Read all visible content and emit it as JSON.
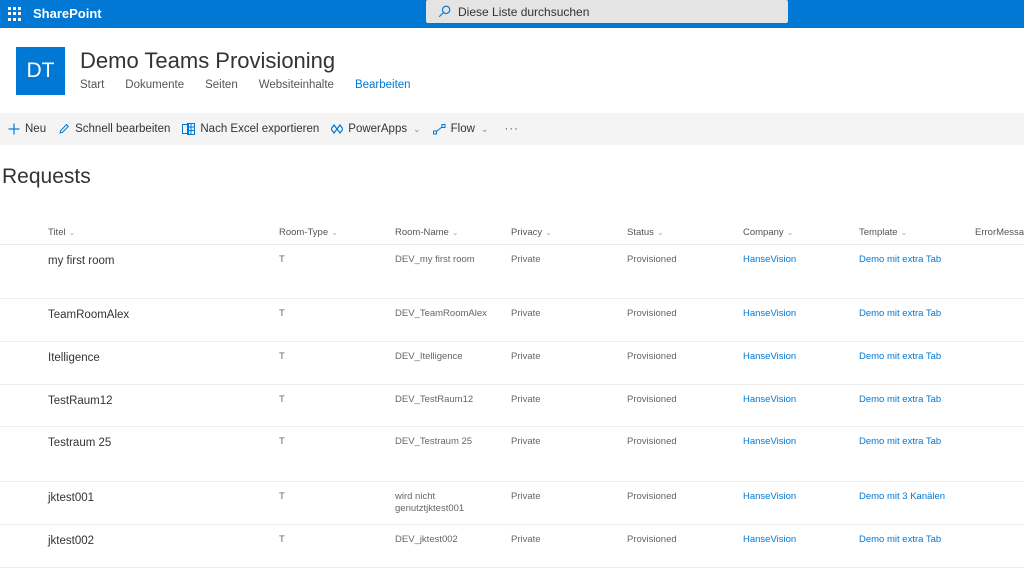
{
  "suitebar": {
    "app_name": "SharePoint",
    "search_placeholder": "Diese Liste durchsuchen",
    "accent_color": "#0078d4"
  },
  "site": {
    "logo_initials": "DT",
    "title": "Demo Teams Provisioning",
    "nav": [
      {
        "label": "Start",
        "active": false
      },
      {
        "label": "Dokumente",
        "active": false
      },
      {
        "label": "Seiten",
        "active": false
      },
      {
        "label": "Websiteinhalte",
        "active": false
      },
      {
        "label": "Bearbeiten",
        "active": true
      }
    ]
  },
  "commandbar": {
    "new_label": "Neu",
    "quick_edit_label": "Schnell bearbeiten",
    "export_label": "Nach Excel exportieren",
    "powerapps_label": "PowerApps",
    "flow_label": "Flow",
    "more_label": "···"
  },
  "list": {
    "title": "Requests",
    "columns": [
      "Titel",
      "Room-Type",
      "Room-Name",
      "Privacy",
      "Status",
      "Company",
      "Template",
      "ErrorMessag"
    ],
    "rows": [
      {
        "title": "my first room",
        "room_type": "T",
        "room_name": "DEV_my first room",
        "privacy": "Private",
        "status": "Provisioned",
        "company": "HanseVision",
        "template": "Demo mit extra Tab",
        "error": ""
      },
      {
        "title": "TeamRoomAlex",
        "room_type": "T",
        "room_name": "DEV_TeamRoomAlex",
        "privacy": "Private",
        "status": "Provisioned",
        "company": "HanseVision",
        "template": "Demo mit extra Tab",
        "error": ""
      },
      {
        "title": "Itelligence",
        "room_type": "T",
        "room_name": "DEV_Itelligence",
        "privacy": "Private",
        "status": "Provisioned",
        "company": "HanseVision",
        "template": "Demo mit extra Tab",
        "error": ""
      },
      {
        "title": "TestRaum12",
        "room_type": "T",
        "room_name": "DEV_TestRaum12",
        "privacy": "Private",
        "status": "Provisioned",
        "company": "HanseVision",
        "template": "Demo mit extra Tab",
        "error": ""
      },
      {
        "title": "Testraum 25",
        "room_type": "T",
        "room_name": "DEV_Testraum 25",
        "privacy": "Private",
        "status": "Provisioned",
        "company": "HanseVision",
        "template": "Demo mit extra Tab",
        "error": ""
      },
      {
        "title": "jktest001",
        "room_type": "T",
        "room_name": "wird nicht genutztjktest001",
        "privacy": "Private",
        "status": "Provisioned",
        "company": "HanseVision",
        "template": "Demo mit 3 Kanälen",
        "error": ""
      },
      {
        "title": "jktest002",
        "room_type": "T",
        "room_name": "DEV_jktest002",
        "privacy": "Private",
        "status": "Provisioned",
        "company": "HanseVision",
        "template": "Demo mit extra Tab",
        "error": ""
      }
    ]
  }
}
